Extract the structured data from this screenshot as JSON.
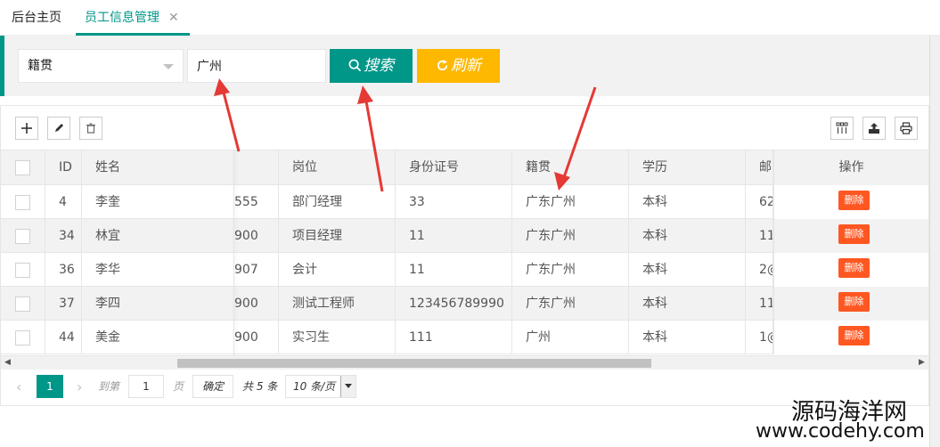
{
  "tabs": {
    "home": "后台主页",
    "active": "员工信息管理",
    "close_symbol": "✕"
  },
  "search": {
    "field_select": "籍贯",
    "keyword": "广州",
    "search_label": "搜索",
    "refresh_label": "刷新"
  },
  "table": {
    "headers": {
      "id": "ID",
      "name": "姓名",
      "position": "岗位",
      "id_card": "身份证号",
      "native_place": "籍贯",
      "education": "学历",
      "email": "邮",
      "operation": "操作"
    },
    "rows": [
      {
        "id": "4",
        "name": "李奎",
        "phone_tail": "555",
        "position": "部门经理",
        "id_card": "33",
        "native_place": "广东广州",
        "education": "本科",
        "email": "62",
        "action": "删除"
      },
      {
        "id": "34",
        "name": "林宜",
        "phone_tail": "900",
        "position": "项目经理",
        "id_card": "11",
        "native_place": "广东广州",
        "education": "本科",
        "email": "11",
        "action": "删除"
      },
      {
        "id": "36",
        "name": "李华",
        "phone_tail": "907",
        "position": "会计",
        "id_card": "11",
        "native_place": "广东广州",
        "education": "本科",
        "email": "2@",
        "action": "删除"
      },
      {
        "id": "37",
        "name": "李四",
        "phone_tail": "900",
        "position": "测试工程师",
        "id_card": "123456789990",
        "native_place": "广东广州",
        "education": "本科",
        "email": "11",
        "action": "删除"
      },
      {
        "id": "44",
        "name": "美金",
        "phone_tail": "900",
        "position": "实习生",
        "id_card": "111",
        "native_place": "广州",
        "education": "本科",
        "email": "1@",
        "action": "删除"
      }
    ]
  },
  "pager": {
    "current_page": "1",
    "goto_label": "到第",
    "goto_value": "1",
    "page_unit": "页",
    "confirm_label": "确定",
    "total_label": "共 5 条",
    "limit_label": "10 条/页"
  },
  "watermark": {
    "line1": "源码海洋网",
    "line2": "www.codehy.com"
  },
  "colors": {
    "primary": "#009688",
    "warm": "#ffb800",
    "danger": "#ff5722"
  }
}
